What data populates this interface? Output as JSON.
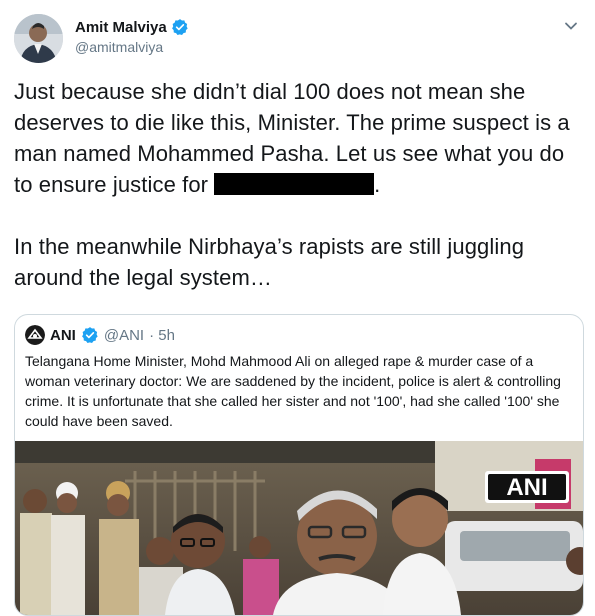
{
  "author": {
    "name": "Amit Malviya",
    "handle": "@amitmalviya"
  },
  "icons": {
    "verified": "verified-badge-icon",
    "caret": "chevron-down-icon"
  },
  "tweet": {
    "paragraph1_before_redaction": "Just because she didn’t dial 100 does not mean she deserves to die like this, Minister. The prime suspect is a man named Mohammed Pasha. Let us see what you do to ensure justice for",
    "paragraph1_after_redaction": ".",
    "paragraph2": "In the meanwhile Nirbhaya’s rapists are still juggling around the legal system…"
  },
  "quoted_tweet": {
    "name": "ANI",
    "handle": "@ANI",
    "time": "· 5h",
    "text": "Telangana Home Minister, Mohd Mahmood Ali on alleged rape & murder case of a woman veterinary doctor: We are saddened by the incident, police is alert & controlling crime. It is unfortunate that she called her sister and not '100', had she called '100' she could have been saved.",
    "image_watermark": "ANI"
  },
  "colors": {
    "verified_blue": "#1da1f2",
    "secondary_text": "#657786",
    "border": "#cfd9de"
  }
}
